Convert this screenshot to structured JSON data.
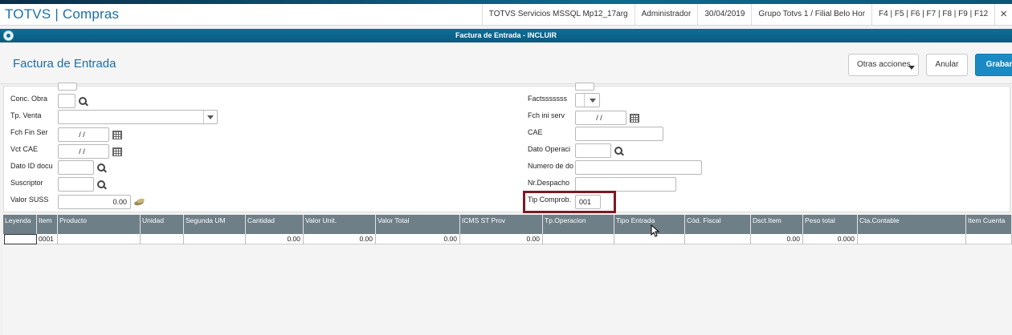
{
  "app": {
    "brand": "TOTVS",
    "brand_sep": "|",
    "module": "Compras",
    "environment": "TOTVS Servicios MSSQL Mp12_17arg",
    "user": "Administrador",
    "date": "30/04/2019",
    "group": "Grupo Totvs 1 / Filial Belo Hor",
    "shortcuts": "F4 | F5 | F6 | F7 | F8 | F9 | F12",
    "close": "×"
  },
  "window": {
    "title": "Factura de Entrada - INCLUIR"
  },
  "panel": {
    "title": "Factura de Entrada",
    "actions": {
      "more": "Otras acciones",
      "cancel": "Anular",
      "save": "Grabar"
    }
  },
  "form": {
    "left": {
      "conc_obra": {
        "label": "Conc. Obra",
        "value": ""
      },
      "tp_venta": {
        "label": "Tp. Venta",
        "value": ""
      },
      "fch_fin_ser": {
        "label": "Fch Fin Ser",
        "value": "  /  /  "
      },
      "vct_cae": {
        "label": "Vct CAE",
        "value": "  /  /  "
      },
      "dato_id_docu": {
        "label": "Dato ID docu",
        "value": ""
      },
      "suscriptor": {
        "label": "Suscriptor",
        "value": ""
      },
      "valor_suss": {
        "label": "Valor SUSS",
        "value": "0.00"
      }
    },
    "right": {
      "factsssss": {
        "label": "Factsssssss",
        "value": ""
      },
      "fch_ini_serv": {
        "label": "Fch ini serv",
        "value": "  /  /  "
      },
      "cae": {
        "label": "CAE",
        "value": ""
      },
      "dato_operaci": {
        "label": "Dato Operaci",
        "value": ""
      },
      "numero_de_do": {
        "label": "Numero de do",
        "value": ""
      },
      "nr_despacho": {
        "label": "Nr.Despacho",
        "value": ""
      },
      "tip_comprob": {
        "label": "Tip Comprob.",
        "value": "001"
      }
    }
  },
  "grid": {
    "columns": [
      "Leyenda",
      "Item",
      "Producto",
      "Unidad",
      "Segunda UM",
      "Cantidad",
      "Valor Unit.",
      "Valor Total",
      "ICMS ST Prov",
      "Tp.Operacion",
      "Tipo Entrada",
      "Cód. Fiscal",
      "Dsct.Item",
      "Peso total",
      "Cta.Contable",
      "Item Cuenta"
    ],
    "rows": [
      [
        "",
        "0001",
        "",
        "",
        "",
        "0.00",
        "0.00",
        "0.00",
        "0.00",
        "",
        "",
        "",
        "0.00",
        "0.000",
        "",
        ""
      ]
    ]
  },
  "colors": {
    "brand_blue": "#1a6fa8",
    "title_bar": "#0e6f98",
    "primary_button": "#1a8ac4",
    "highlight_box": "#7a1a25",
    "grid_header": "#6f7f88"
  }
}
